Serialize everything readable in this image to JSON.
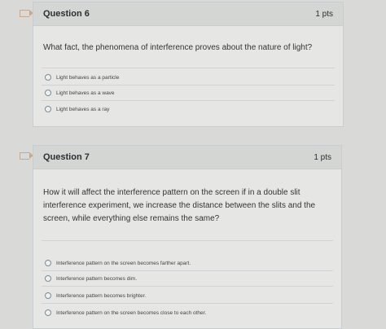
{
  "q6": {
    "title": "Question 6",
    "points": "1 pts",
    "prompt": "What fact, the phenomena of interference proves about the nature of light?",
    "options": [
      "Light behaves as a particle",
      "Light behaves as a wave",
      "Light behaves as a ray"
    ]
  },
  "q7": {
    "title": "Question 7",
    "points": "1 pts",
    "prompt": "How it will affect the interference pattern on the screen if in a double slit interference experiment, we increase the distance between the slits and the screen, while everything else remains the same?",
    "options": [
      "Interference pattern on the screen becomes farther apart.",
      "Interference pattern becomes dim.",
      "Interference pattern becomes brighter.",
      "Interference pattern on the screen becomes close to each other."
    ]
  }
}
